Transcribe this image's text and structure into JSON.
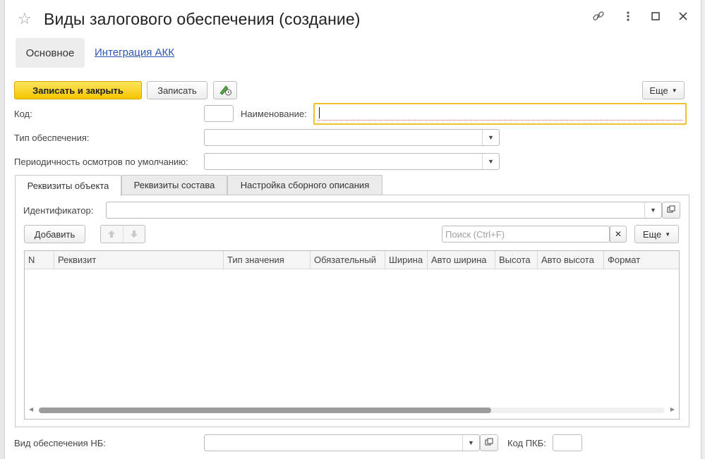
{
  "window": {
    "title": "Виды залогового обеспечения (создание)"
  },
  "sections": {
    "main": "Основное",
    "integration": "Интеграция АКК"
  },
  "toolbar": {
    "save_close": "Записать и закрыть",
    "save": "Записать",
    "more": "Еще"
  },
  "form": {
    "code_label": "Код:",
    "code_value": "",
    "name_label": "Наименование:",
    "name_value": "",
    "type_label": "Тип обеспечения:",
    "type_value": "",
    "period_label": "Периодичность осмотров по умолчанию:",
    "period_value": "",
    "nb_label": "Вид обеспечения НБ:",
    "nb_value": "",
    "pkb_label": "Код ПКБ:",
    "pkb_value": ""
  },
  "tabs": [
    {
      "label": "Реквизиты объекта",
      "active": true
    },
    {
      "label": "Реквизиты состава",
      "active": false
    },
    {
      "label": "Настройка сборного описания",
      "active": false
    }
  ],
  "panel": {
    "identifier_label": "Идентификатор:",
    "identifier_value": "",
    "add_button": "Добавить",
    "search_placeholder": "Поиск (Ctrl+F)",
    "more": "Еще"
  },
  "table": {
    "columns": [
      "N",
      "Реквизит",
      "Тип значения",
      "Обязательный",
      "Ширина",
      "Авто ширина",
      "Высота",
      "Авто высота",
      "Формат"
    ],
    "rows": []
  },
  "colors": {
    "accent_yellow": "#f4c600",
    "link_blue": "#2f55b8",
    "focus_border": "#f2c02a"
  },
  "icons": [
    "star-icon",
    "link-icon",
    "kebab-menu-icon",
    "maximize-icon",
    "close-icon",
    "edit-history-icon",
    "dropdown-arrow-icon",
    "open-form-icon",
    "move-up-icon",
    "move-down-icon",
    "clear-search-icon"
  ]
}
